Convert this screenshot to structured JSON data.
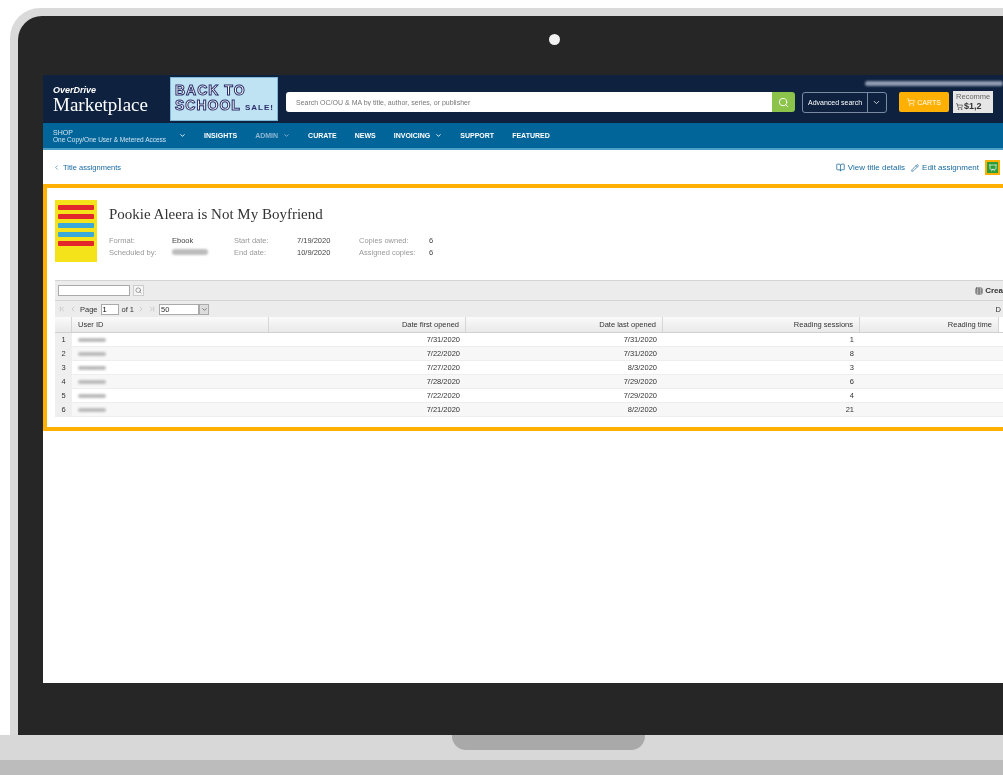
{
  "header": {
    "logo_brand": "OverDrive",
    "logo_product": "Marketplace",
    "banner": {
      "line_1": "BACK TO",
      "line_2": "SCHOOL",
      "badge": "SALE!"
    },
    "account_blurred": true,
    "search": {
      "placeholder": "Search OC/OU & MA by title, author, series, or publisher"
    },
    "advanced_search": "Advanced search",
    "carts": "CARTS",
    "recommend": {
      "label": "Recomme",
      "amount": "$1,2"
    }
  },
  "nav": [
    {
      "label": "SHOP",
      "sublabel": "One Copy/One User & Metered Access",
      "dropdown": true,
      "selected": false
    },
    {
      "label": "INSIGHTS",
      "dropdown": false,
      "selected": false
    },
    {
      "label": "ADMIN",
      "dropdown": true,
      "selected": true
    },
    {
      "label": "CURATE",
      "dropdown": false,
      "selected": false
    },
    {
      "label": "NEWS",
      "dropdown": false,
      "selected": false
    },
    {
      "label": "INVOICING",
      "dropdown": true,
      "selected": false
    },
    {
      "label": "SUPPORT",
      "dropdown": false,
      "selected": false
    },
    {
      "label": "FEATURED",
      "dropdown": false,
      "selected": false
    }
  ],
  "breadcrumb": "Title assignments",
  "actions": {
    "view_details": "View title details",
    "edit": "Edit assignment"
  },
  "book": {
    "title": "Pookie Aleera is Not My Boyfriend",
    "meta": [
      {
        "label": "Format:",
        "value": "Ebook"
      },
      {
        "label": "Start date:",
        "value": "7/19/2020"
      },
      {
        "label": "Copies owned:",
        "value": "6"
      },
      {
        "label": "Scheduled by:",
        "blurred": true
      },
      {
        "label": "End date:",
        "value": "10/9/2020"
      },
      {
        "label": "Assigned copies:",
        "value": "6"
      }
    ]
  },
  "grid": {
    "create_label": "Crea",
    "page_label": "Page",
    "page": "1",
    "page_of": "of 1",
    "page_size": "50",
    "pager_right": "D",
    "columns": [
      "User ID",
      "Date first opened",
      "Date last opened",
      "Reading sessions",
      "Reading time"
    ],
    "rows": [
      {
        "num": "1",
        "user_blurred": true,
        "date_first": "7/31/2020",
        "date_last": "7/31/2020",
        "sessions": "1"
      },
      {
        "num": "2",
        "user_blurred": true,
        "date_first": "7/22/2020",
        "date_last": "7/31/2020",
        "sessions": "8"
      },
      {
        "num": "3",
        "user_blurred": true,
        "date_first": "7/27/2020",
        "date_last": "8/3/2020",
        "sessions": "3"
      },
      {
        "num": "4",
        "user_blurred": true,
        "date_first": "7/28/2020",
        "date_last": "7/29/2020",
        "sessions": "6"
      },
      {
        "num": "5",
        "user_blurred": true,
        "date_first": "7/22/2020",
        "date_last": "7/29/2020",
        "sessions": "4"
      },
      {
        "num": "6",
        "user_blurred": true,
        "date_first": "7/21/2020",
        "date_last": "8/2/2020",
        "sessions": "21"
      }
    ]
  }
}
